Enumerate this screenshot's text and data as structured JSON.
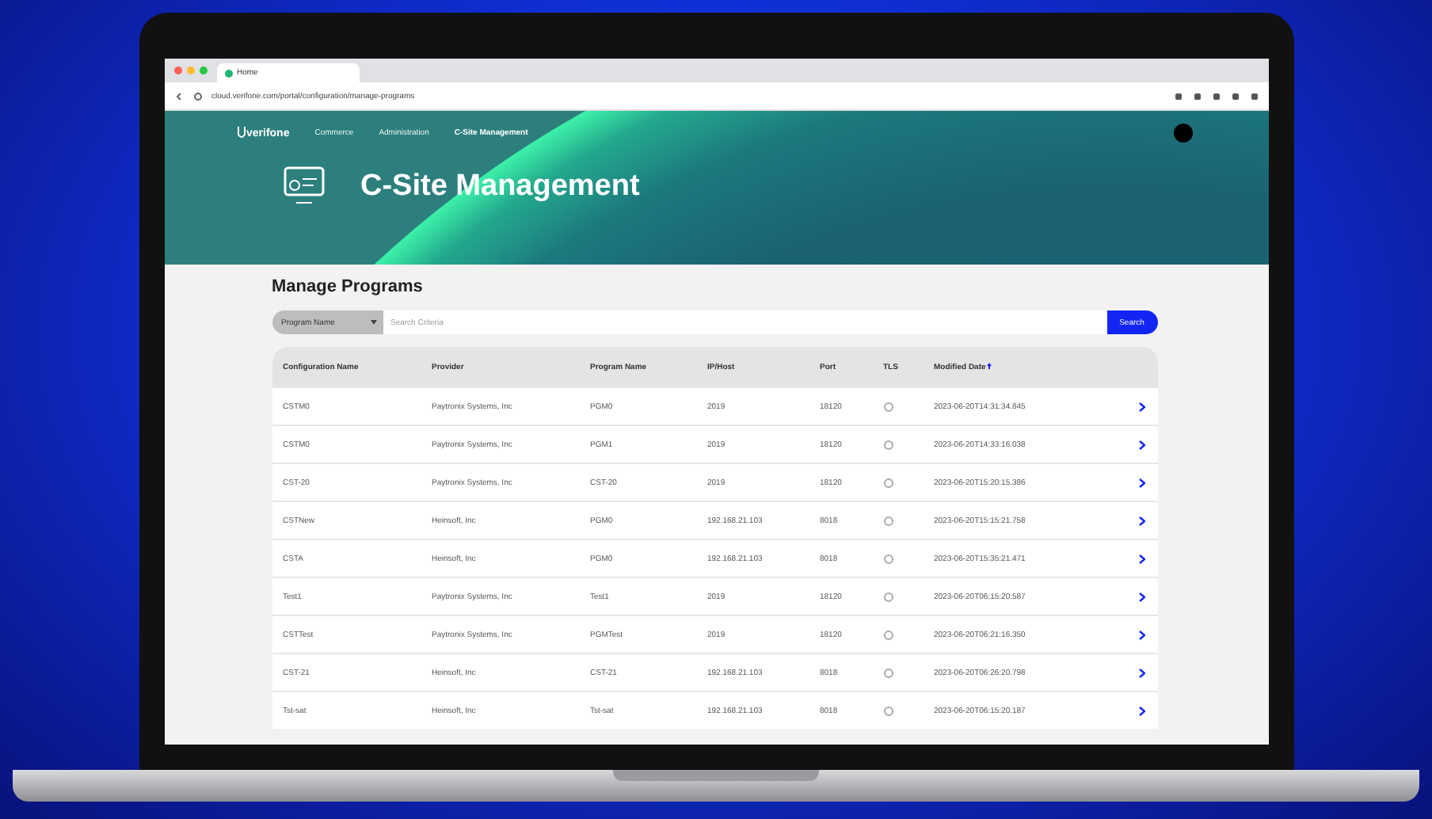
{
  "browser": {
    "tab_title": "Home",
    "url": "cloud.verifone.com/portal/configuration/manage-programs"
  },
  "header": {
    "brand": "verifone",
    "nav": [
      {
        "label": "Commerce",
        "selected": false
      },
      {
        "label": "Administration",
        "selected": false
      },
      {
        "label": "C-Site Management",
        "selected": true
      }
    ],
    "title": "C-Site Management"
  },
  "page": {
    "title": "Manage Programs",
    "filter": {
      "value": "Program Name"
    },
    "search": {
      "placeholder": "Search Criteria"
    },
    "search_button": "Search"
  },
  "table": {
    "columns": [
      "Configuration Name",
      "Provider",
      "Program Name",
      "IP/Host",
      "Port",
      "TLS",
      "Modified Date"
    ],
    "rows": [
      {
        "cells": [
          "CSTM0",
          "Paytronix Systems, Inc",
          "PGM0",
          "2019",
          "18120"
        ],
        "tls": false,
        "modified": "2023-06-20T14:31:34.845"
      },
      {
        "cells": [
          "CSTM0",
          "Paytronix Systems, Inc",
          "PGM1",
          "2019",
          "18120"
        ],
        "tls": false,
        "modified": "2023-06-20T14:33:16.038"
      },
      {
        "cells": [
          "CST-20",
          "Paytronix Systems, Inc",
          "CST-20",
          "2019",
          "18120"
        ],
        "tls": false,
        "modified": "2023-06-20T15:20:15.386"
      },
      {
        "cells": [
          "CSTNew",
          "Heinsoft, Inc",
          "PGM0",
          "192.168.21.103",
          "8018"
        ],
        "tls": false,
        "modified": "2023-06-20T15:15:21.758"
      },
      {
        "cells": [
          "CSTA",
          "Heinsoft, Inc",
          "PGM0",
          "192.168.21.103",
          "8018"
        ],
        "tls": false,
        "modified": "2023-06-20T15:35:21.471"
      },
      {
        "cells": [
          "Test1",
          "Paytronix Systems, Inc",
          "Test1",
          "2019",
          "18120"
        ],
        "tls": false,
        "modified": "2023-06-20T06:15:20.587"
      },
      {
        "cells": [
          "CSTTest",
          "Paytronix Systems, Inc",
          "PGMTest",
          "2019",
          "18120"
        ],
        "tls": false,
        "modified": "2023-06-20T06:21:16.350"
      },
      {
        "cells": [
          "CST-21",
          "Heinsoft, Inc",
          "CST-21",
          "192.168.21.103",
          "8018"
        ],
        "tls": false,
        "modified": "2023-06-20T06:26:20.798"
      },
      {
        "cells": [
          "Tst-sat",
          "Heinsoft, Inc",
          "Tst-sat",
          "192.168.21.103",
          "8018"
        ],
        "tls": false,
        "modified": "2023-06-20T06:15:20.187"
      }
    ]
  }
}
